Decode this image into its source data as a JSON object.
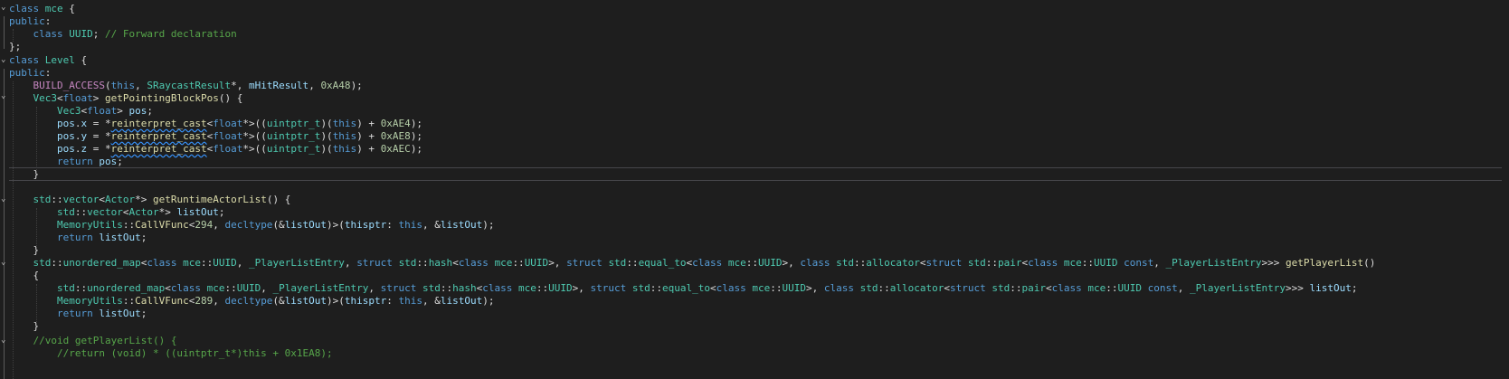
{
  "editor": {
    "lines": [
      "class mce {",
      "public:",
      "    class UUID; // Forward declaration",
      "};",
      "class Level {",
      "public:",
      "    BUILD_ACCESS(this, SRaycastResult*, mHitResult, 0xA48);",
      "    Vec3<float> getPointingBlockPos() {",
      "        Vec3<float> pos;",
      "        pos.x = *reinterpret_cast<float*>((uintptr_t)(this) + 0xAE4);",
      "        pos.y = *reinterpret_cast<float*>((uintptr_t)(this) + 0xAE8);",
      "        pos.z = *reinterpret_cast<float*>((uintptr_t)(this) + 0xAEC);",
      "        return pos;",
      "    }",
      "",
      "    std::vector<Actor*> getRuntimeActorList() {",
      "        std::vector<Actor*> listOut;",
      "        MemoryUtils::CallVFunc<294, decltype(&listOut)>(thisptr: this, &listOut);",
      "        return listOut;",
      "    }",
      "    std::unordered_map<class mce::UUID, _PlayerListEntry, struct std::hash<class mce::UUID>, struct std::equal_to<class mce::UUID>, class std::allocator<struct std::pair<class mce::UUID const, _PlayerListEntry>>> getPlayerList()",
      "    {",
      "        std::unordered_map<class mce::UUID, _PlayerListEntry, struct std::hash<class mce::UUID>, struct std::equal_to<class mce::UUID>, class std::allocator<struct std::pair<class mce::UUID const, _PlayerListEntry>>> listOut;",
      "        MemoryUtils::CallVFunc<289, decltype(&listOut)>(thisptr: this, &listOut);",
      "        return listOut;",
      "    }",
      "    //void getPlayerList() {",
      "        //return (void) * ((uintptr_t*)this + 0x1EA8);"
    ],
    "inlay_hint": "thisptr:"
  }
}
